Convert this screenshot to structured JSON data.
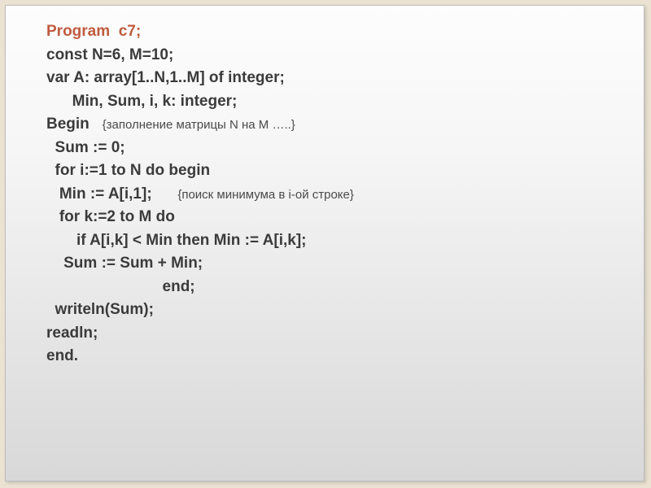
{
  "code": {
    "l1a": "Program  c7;",
    "l2": "const N=6, M=10;",
    "l3": "var A: array[1..N,1..M] of integer;",
    "l4": "      Min, Sum, i, k: integer;",
    "l5a": "Begin   ",
    "l5b": "{заполнение матрицы N на M …..}",
    "l6": "  Sum := 0;",
    "l7": "  for i:=1 to N do begin",
    "l8a": "   Min := A[i,1];      ",
    "l8b": "{поиск минимума в i-ой строке}",
    "l9": "   for k:=2 to M do",
    "l10": "       if A[i,k] < Min then Min := A[i,k];",
    "l11": "    Sum := Sum + Min;",
    "l12": "                           end;",
    "l13": "  writeln(Sum);",
    "l14": "readln;",
    "l15": "end."
  }
}
